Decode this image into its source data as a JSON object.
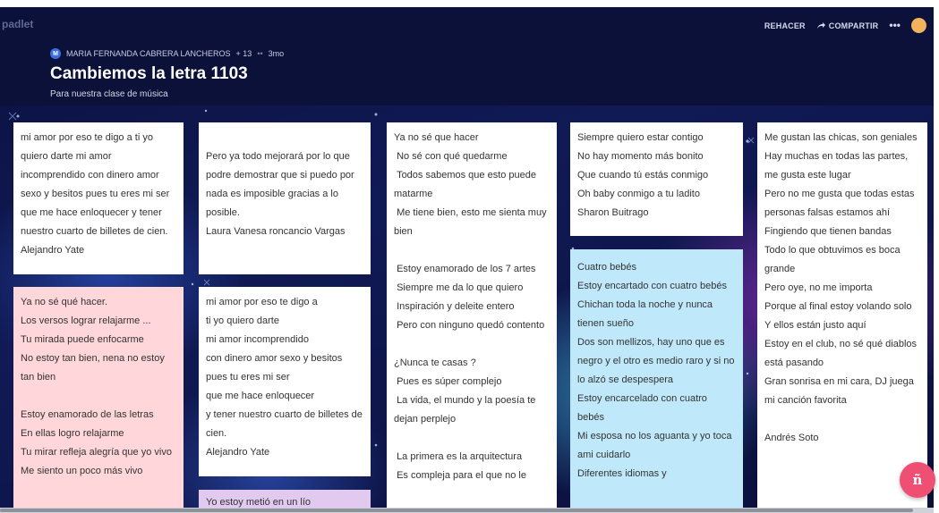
{
  "app": {
    "logo": "padlet"
  },
  "header": {
    "actions": {
      "redo": "REHACER",
      "share": "COMPARTIR",
      "more": "•••"
    },
    "author_initial": "M",
    "author": "MARIA FERNANDA CABRERA LANCHEROS",
    "plus": "+ 13",
    "dots": "••",
    "time": "3mo",
    "title": "Cambiemos la letra 1103",
    "subtitle": "Para nuestra clase de música"
  },
  "posts": [
    {
      "color": "white",
      "body": "mi amor por eso te digo a ti yo quiero darte mi amor incomprendido con dinero amor sexo y besitos pues tu eres mi ser que me hace enloquecer y tener nuestro cuarto de billetes de cien. Alejandro Yate"
    },
    {
      "color": "pink",
      "body": "Ya no sé qué hacer.\nLos versos lograr relajarme ...\nTu mirada puede enfocarme\nNo estoy tan bien, nena no estoy tan bien\n\nEstoy enamorado de las letras\nEn ellas logro relajarme\nTu mirar refleja alegría que yo vivo\nMe siento un poco más vivo"
    },
    {
      "color": "white",
      "body": "Pero ya todo mejorará por lo que podre demostrar que si puedo por nada es imposible gracias a lo posible.\nLaura Vanesa roncancio Vargas"
    },
    {
      "color": "white",
      "body": "mi amor por eso te digo a\nti yo quiero darte\nmi amor incomprendido\ncon dinero amor sexo y besitos\npues tu eres mi ser\nque me hace enloquecer\ny tener nuestro cuarto de billetes de cien.\nAlejandro Yate"
    },
    {
      "color": "lilac",
      "body": "Yo estoy metió en un lío"
    },
    {
      "color": "white",
      "body": "Ya no sé que hacer\n No sé con qué quedarme\n Todos sabemos que esto puede matarme\n Me tiene bien, esto me sienta muy bien\n\n Estoy enamorado de los 7 artes\n Siempre me da lo que quiero\n Inspiración y deleite entero\n Pero con ninguno quedó contento\n\n¿Nunca te casas ?\n Pues es súper complejo\n La vida, el mundo y la poesía te dejan perplejo\n\n La primera es la arquitectura\n Es compleja para el que no le"
    },
    {
      "color": "white",
      "body": "Siempre quiero estar contigo\nNo hay momento más bonito\nQue cuando tú estás conmigo\nOh baby conmigo a tu ladito\nSharon Buitrago"
    },
    {
      "color": "cyan",
      "body": "Cuatro bebés\nEstoy encartado con cuatro bebés\nChichan toda la noche y nunca tienen sueño\nDos son mellizos, hay uno que es negro y el otro es medio raro y si no lo alzó se despespera\nEstoy encarcelado con cuatro bebés\nMi esposa no los aguanta y yo toca ami cuidarlo\nDiferentes idiomas y"
    },
    {
      "color": "white",
      "body": "Me gustan las chicas, son geniales\nHay muchas en todas las partes, me gusta este lugar\nPero no me gusta que todas estas personas falsas estamos ahí\nFingiendo que tienen bandas\nTodo lo que obtuvimos es boca grande\nPero oye, no me importa\nPorque al final estoy volando solo\nY ellos están justo aquí\nEstoy en el club, no sé qué diablos está pasando\nGran sonrisa en mi cara, DJ juega mi canción favorita\n\nAndrés Soto"
    }
  ],
  "fab": {
    "label": "ñ"
  }
}
